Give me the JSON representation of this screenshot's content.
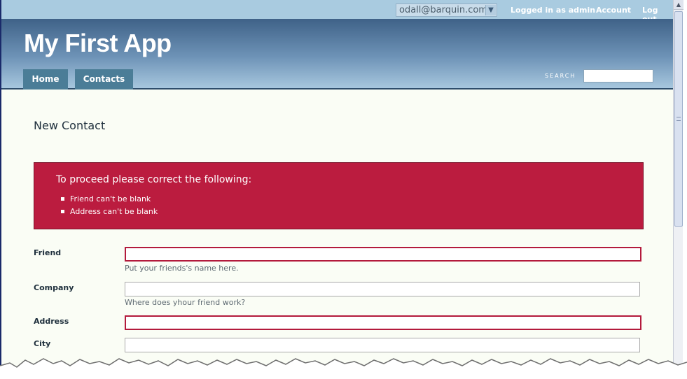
{
  "topbar": {
    "account_value": "odall@barquin.com",
    "logged_in_text": "Logged in as admin",
    "account_link": "Account",
    "logout_link": "Log out"
  },
  "header": {
    "app_title": "My First App",
    "tabs": [
      {
        "label": "Home"
      },
      {
        "label": "Contacts"
      }
    ],
    "search_label": "SEARCH",
    "search_value": ""
  },
  "main": {
    "page_title": "New Contact",
    "error": {
      "heading": "To proceed please correct the following:",
      "items": [
        "Friend can't be blank",
        "Address can't be blank"
      ]
    },
    "fields": [
      {
        "label": "Friend",
        "value": "",
        "hint": "Put your friends's name here.",
        "has_error": true
      },
      {
        "label": "Company",
        "value": "",
        "hint": "Where does yhour friend work?",
        "has_error": false
      },
      {
        "label": "Address",
        "value": "",
        "hint": "",
        "has_error": true
      },
      {
        "label": "City",
        "value": "",
        "hint": "",
        "has_error": false
      }
    ]
  },
  "colors": {
    "header_top": "#3f6288",
    "header_bottom": "#a7c7de",
    "tab_bg": "#4b7d97",
    "error_bg": "#bb1c3f",
    "error_border": "#b31a3c",
    "page_bg": "#fafdf5"
  },
  "icons": {
    "select_chevron": "chevron-down-icon",
    "scroll_up": "arrow-up-icon"
  }
}
